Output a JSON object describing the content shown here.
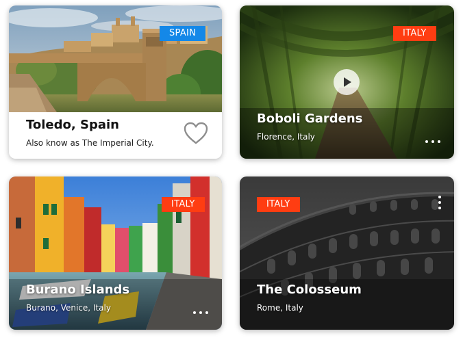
{
  "cards": [
    {
      "badge": "SPAIN",
      "badge_color": "#1488e8",
      "title": "Toledo, Spain",
      "subtitle": "Also know as The Imperial City.",
      "action_icon": "heart-outline-icon"
    },
    {
      "badge": "ITALY",
      "badge_color": "#ff3d12",
      "title": "Boboli Gardens",
      "subtitle": "Florence, Italy",
      "overlay_icon": "play-icon",
      "menu_icon": "more-horizontal-icon"
    },
    {
      "badge": "ITALY",
      "badge_color": "#ff3d12",
      "title": "Burano Islands",
      "subtitle": "Burano, Venice, Italy",
      "menu_icon": "more-horizontal-icon"
    },
    {
      "badge": "ITALY",
      "badge_color": "#ff3d12",
      "title": "The Colosseum",
      "subtitle": "Rome, Italy",
      "menu_icon": "more-vertical-icon"
    }
  ]
}
